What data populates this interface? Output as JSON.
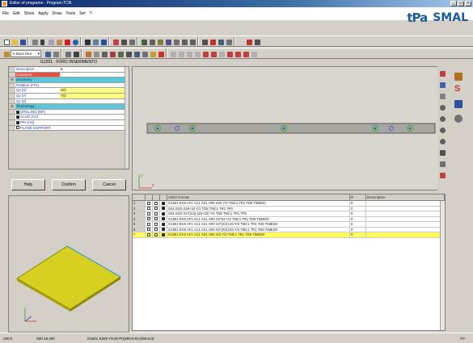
{
  "window": {
    "title": "Editor of programs - Program.TCN"
  },
  "menu": [
    "File",
    "Edit",
    "Show",
    "Apply",
    "Draw",
    "Tools",
    "Set",
    "?"
  ],
  "brand": {
    "left": "tPa",
    "right": "SMAL"
  },
  "face_select": {
    "value": "5 Back face"
  },
  "param_panel": {
    "header": "G1501 - FORO INSERIMENTO",
    "rows": [
      {
        "label": "Description",
        "value": "6",
        "style": "plain"
      },
      {
        "label": "Comment",
        "value": "",
        "style": "red"
      },
      {
        "label": "Geometry",
        "value": "",
        "style": "sect"
      },
      {
        "label": "Relative (F/G)",
        "value": "",
        "style": "plain"
      },
      {
        "label": "Qx [X]",
        "value": "X/2",
        "style": "yel"
      },
      {
        "label": "Qy [Y]",
        "value": "Y/2",
        "style": "yel"
      },
      {
        "label": "Qz [Z]",
        "value": "",
        "style": "plain"
      },
      {
        "label": "Technology",
        "value": "",
        "style": "sect"
      },
      {
        "label": "DRILLING [MF]",
        "value": "",
        "style": "checked"
      },
      {
        "label": "GLUE [AC]",
        "value": "",
        "style": "checked"
      },
      {
        "label": "PIN [AS]",
        "value": "",
        "style": "checked"
      },
      {
        "label": "PLANE SUPPORT",
        "value": "",
        "style": "check"
      }
    ]
  },
  "buttons": {
    "help": "Help",
    "confirm": "Confirm",
    "cancel": "Cancel"
  },
  "axes": {
    "y": "y",
    "x": "x"
  },
  "grid": {
    "headers": {
      "iso": "ASCII format",
      "r": "R",
      "desc": "Description"
    },
    "rows": [
      {
        "n": "1",
        "text": "G1501 EG0 AF1 AC1 AS1 AR0 X20 Y/2 TMC1 TR1 TD8 TIMED0",
        "r": "0"
      },
      {
        "n": "2",
        "text": "G81 EG0 X20+32 Y/2 TD8 TMC1 TR1 TP0",
        "r": "0"
      },
      {
        "n": "3",
        "text": "G81 EG0 X2*(X/2)-(20+32) Y/2 TD8 TMC1 TR1 TP0",
        "r": "0"
      },
      {
        "n": "4",
        "text": "G1501 EG0 AF1 AC1 AS1 AR0 X2*84 Y/2 TMC1 TR1 TD8 TIMED0",
        "r": "0"
      },
      {
        "n": "5",
        "text": "G1501 EG0 AF1 AC1 AS1 AR0 X2*(X/2)-20 Y/2 TMC1 TR1 TD8 TIMED0",
        "r": "0"
      },
      {
        "n": "6",
        "text": "G1501 EG0 AF1 AC1 AS1 AR0 X2*(X/2)-84 Y/2 TMC1 TR1 TD8 TIMED0",
        "r": "0"
      },
      {
        "n": "7",
        "text": "G1501 EG0 AF1 AC1 AS1 AR0 X/2 Y/2 TMC1 TR1 TD8 TIMED0",
        "r": "0",
        "selected": true
      }
    ]
  },
  "status": {
    "zoom": "100.0",
    "coords": "500.18.400",
    "info": "G1501 X250 Y9.20 P0(250.9.0)-(250.9.0)",
    "page": "7/7"
  }
}
